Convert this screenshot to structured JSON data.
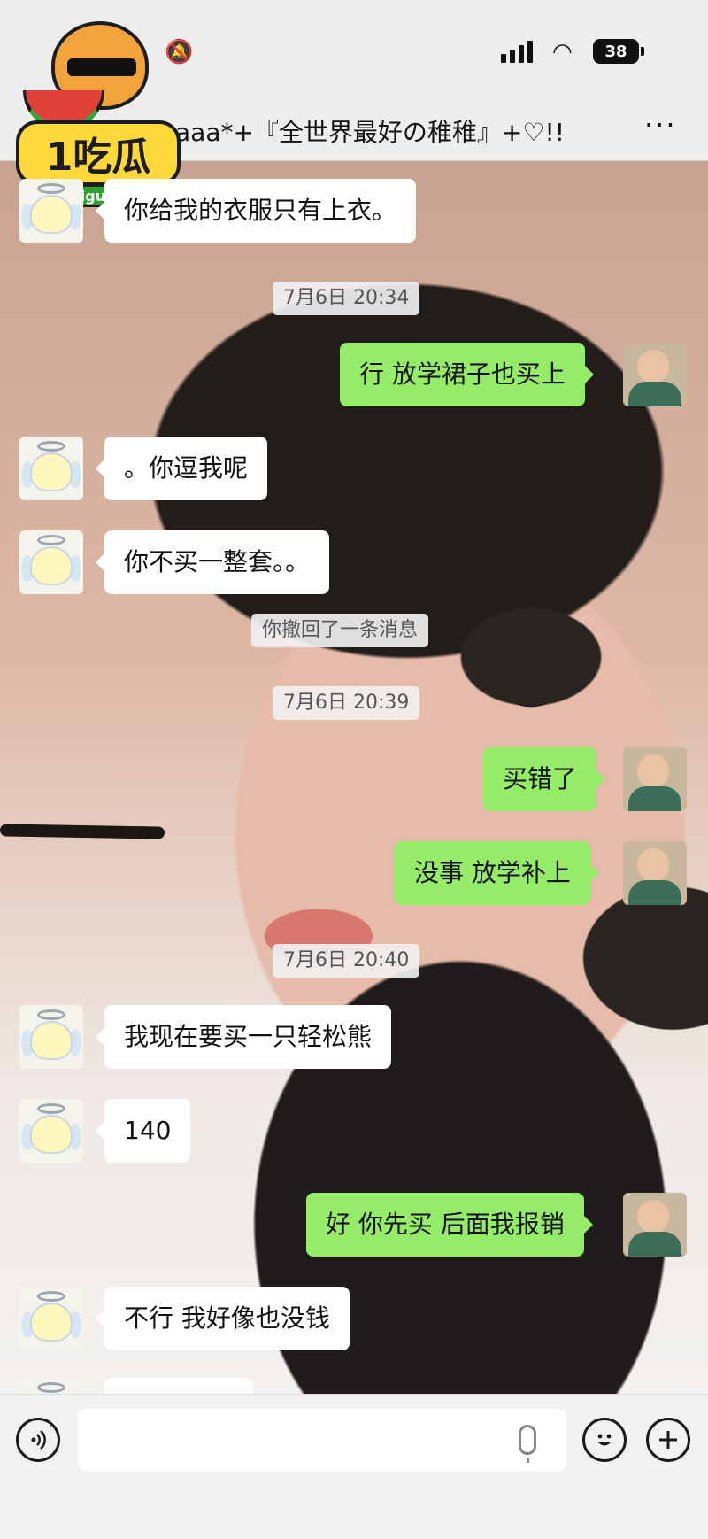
{
  "status_bar": {
    "battery": "38"
  },
  "nav": {
    "title": "aaa*+『全世界最好の稚稚』+♡!!",
    "more": "···"
  },
  "logo": {
    "text": "1吃瓜",
    "url": "1chigua.one"
  },
  "messages": [
    {
      "side": "left",
      "text": "你给我的衣服只有上衣。"
    },
    {
      "type": "time",
      "text": "7月6日 20:34"
    },
    {
      "side": "right",
      "text": "行 放学裙子也买上"
    },
    {
      "side": "left",
      "text": "。你逗我呢"
    },
    {
      "side": "left",
      "text": "你不买一整套。。"
    },
    {
      "type": "system",
      "text": "你撤回了一条消息"
    },
    {
      "type": "time",
      "text": "7月6日 20:39"
    },
    {
      "side": "right",
      "text": "买错了"
    },
    {
      "side": "right",
      "text": "没事 放学补上"
    },
    {
      "type": "time",
      "text": "7月6日 20:40"
    },
    {
      "side": "left",
      "text": "我现在要买一只轻松熊"
    },
    {
      "side": "left",
      "text": "140"
    },
    {
      "side": "right",
      "text": "好 你先买 后面我报销"
    },
    {
      "side": "left",
      "text": "不行 我好像也没钱"
    }
  ],
  "input_bar": {
    "placeholder": ""
  }
}
